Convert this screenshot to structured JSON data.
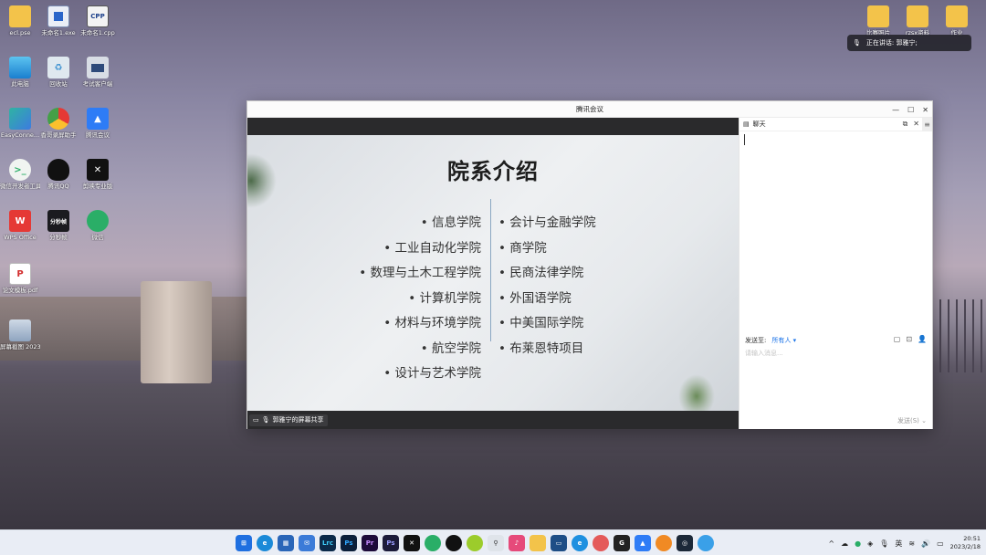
{
  "desktop": {
    "icons": [
      {
        "label": "ecl.pse"
      },
      {
        "label": "未命名1.exe"
      },
      {
        "label": "未命名1.cpp",
        "glyph": "CPP"
      },
      {
        "label": "此电脑"
      },
      {
        "label": "回收站"
      },
      {
        "label": "考试客户端"
      },
      {
        "label": "EasyConne..."
      },
      {
        "label": "香哥录屏助手"
      },
      {
        "label": "腾讯会议"
      },
      {
        "label": "微信开发者工具"
      },
      {
        "label": "腾讯QQ"
      },
      {
        "label": "剪映专业版"
      },
      {
        "label": "WPS Office",
        "glyph": "W"
      },
      {
        "label": "分秒帧",
        "glyph": "分秒帧"
      },
      {
        "label": "微信"
      },
      {
        "label": "论文模板.pdf",
        "glyph": "P"
      },
      {
        "label": "屏幕截图 2023-02-1..."
      }
    ],
    "right_icons": [
      {
        "label": "比赛照片"
      },
      {
        "label": "rzsx资料"
      },
      {
        "label": "作业"
      }
    ]
  },
  "notification": {
    "text": "正在讲话: 郭雅宁;"
  },
  "window": {
    "title": "腾讯会议",
    "slide": {
      "title": "院系介绍",
      "left_items": [
        "• 信息学院",
        "• 工业自动化学院",
        "• 数理与土木工程学院",
        "• 计算机学院",
        "• 材料与环境学院",
        "• 航空学院",
        "• 设计与艺术学院"
      ],
      "right_items": [
        "• 会计与金融学院",
        "• 商学院",
        "• 民商法律学院",
        "• 外国语学院",
        "• 中美国际学院",
        "• 布莱恩特项目"
      ]
    },
    "share_label": "郭雅宁的屏幕共享",
    "chat": {
      "title": "聊天",
      "send_to_label": "发送至:",
      "send_to_value": "所有人 ▾",
      "input_placeholder": "请输入消息...",
      "send_button": "发送(S)"
    }
  },
  "taskbar": {
    "ime": "英",
    "time": "20:51",
    "date": "2023/2/18"
  }
}
